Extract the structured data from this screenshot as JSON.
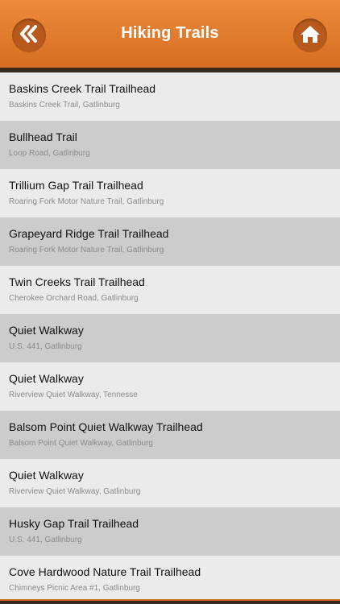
{
  "header": {
    "title": "Hiking Trails",
    "back_icon": "double-chevron-left-icon",
    "home_icon": "home-icon",
    "accent_color": "#e07b2d"
  },
  "trails": [
    {
      "name": "Baskins Creek Trail Trailhead",
      "location": "Baskins Creek Trail, Gatlinburg"
    },
    {
      "name": "Bullhead Trail",
      "location": "Loop Road, Gatlinburg"
    },
    {
      "name": "Trillium Gap Trail Trailhead",
      "location": "Roaring Fork Motor Nature Trail, Gatlinburg"
    },
    {
      "name": "Grapeyard Ridge Trail Trailhead",
      "location": "Roaring Fork Motor Nature Trail, Gatlinburg"
    },
    {
      "name": "Twin Creeks Trail Trailhead",
      "location": "Cherokee Orchard Road, Gatlinburg"
    },
    {
      "name": "Quiet Walkway",
      "location": "U.S. 441, Gatlinburg"
    },
    {
      "name": "Quiet Walkway",
      "location": "Riverview Quiet Walkway, Tennesse"
    },
    {
      "name": "Balsom Point Quiet Walkway Trailhead",
      "location": "Balsom Point Quiet Walkway, Gatlinburg"
    },
    {
      "name": "Quiet Walkway",
      "location": "Riverview Quiet Walkway, Gatlinburg"
    },
    {
      "name": "Husky Gap Trail Trailhead",
      "location": "U.S. 441, Gatlinburg"
    },
    {
      "name": "Cove Hardwood Nature Trail Trailhead",
      "location": "Chimneys Picnic Area #1, Gatlinburg"
    }
  ]
}
